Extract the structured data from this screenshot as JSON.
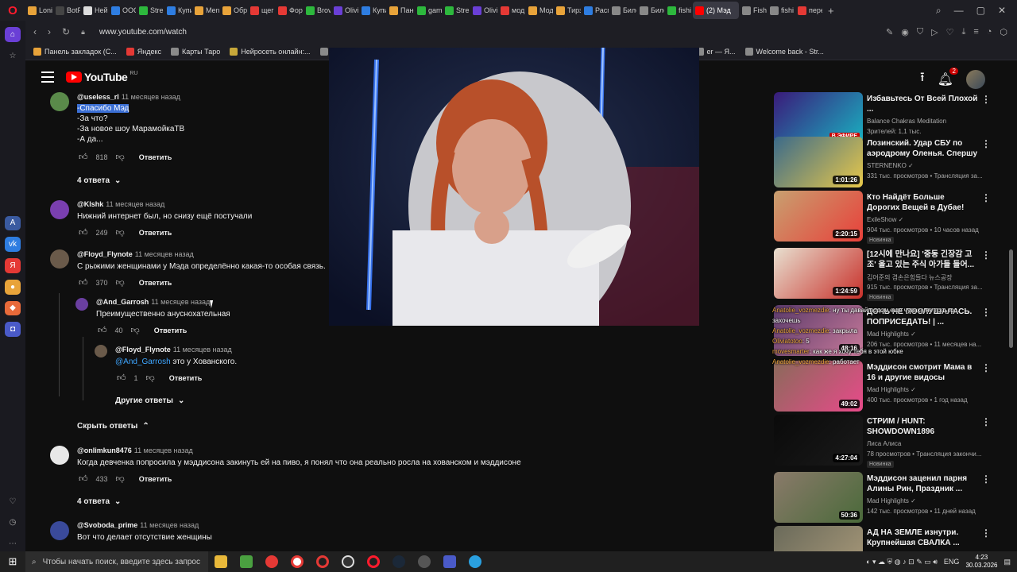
{
  "browser": {
    "tabs": [
      {
        "label": "Loni",
        "color": "#e8a33a"
      },
      {
        "label": "BotF",
        "color": "#444"
      },
      {
        "label": "Ней:",
        "color": "#ddd"
      },
      {
        "label": "OOC",
        "color": "#2e7de1"
      },
      {
        "label": "Stre",
        "color": "#2db83d"
      },
      {
        "label": "Купи",
        "color": "#2e7de1"
      },
      {
        "label": "Men",
        "color": "#e8a33a"
      },
      {
        "label": "Обр",
        "color": "#e8a33a"
      },
      {
        "label": "щег",
        "color": "#e53935"
      },
      {
        "label": "Фор",
        "color": "#e53935"
      },
      {
        "label": "Brov",
        "color": "#2db83d"
      },
      {
        "label": "Olivi",
        "color": "#6a3fd6"
      },
      {
        "label": "Купи",
        "color": "#2e7de1"
      },
      {
        "label": "Пане",
        "color": "#e8a33a"
      },
      {
        "label": "gam",
        "color": "#2db83d"
      },
      {
        "label": "Stre",
        "color": "#2db83d"
      },
      {
        "label": "Olivi",
        "color": "#6a3fd6"
      },
      {
        "label": "мод",
        "color": "#e53935"
      },
      {
        "label": "Мод",
        "color": "#e8a33a"
      },
      {
        "label": "Тирз",
        "color": "#e8a33a"
      },
      {
        "label": "Расп",
        "color": "#2e7de1"
      },
      {
        "label": "Биле",
        "color": "#888"
      },
      {
        "label": "Биле",
        "color": "#888"
      },
      {
        "label": "fishi",
        "color": "#2db83d"
      },
      {
        "label": "(2) Мэд",
        "color": "#ff0000",
        "active": true
      },
      {
        "label": "Fishi",
        "color": "#888"
      },
      {
        "label": "fishi",
        "color": "#888"
      },
      {
        "label": "пере",
        "color": "#e53935"
      }
    ],
    "url": "www.youtube.com/watch",
    "bookmarks": [
      {
        "label": "Панель закладок (С...",
        "color": "#e8a33a"
      },
      {
        "label": "Яндекс",
        "color": "#e53935"
      },
      {
        "label": "Карты Таро",
        "color": "#8a8a8a"
      },
      {
        "label": "Нейросеть онлайн:...",
        "color": "#c8a83a"
      },
      {
        "label": "Гадания он",
        "color": "#8a8a8a"
      },
      {
        "label": "er — Я...",
        "color": "#8a8a8a"
      },
      {
        "label": "Welcome back - Str...",
        "color": "#8a8a8a"
      }
    ]
  },
  "youtube": {
    "logo_text": "YouTube",
    "region": "RU",
    "notif_count": "2"
  },
  "comments": [
    {
      "author": "@useless_rl",
      "time": "11 месяцев назад",
      "highlight": "-Спасибо Мэд",
      "text": "-За что?\n-За новое шоу МарамойкаТВ\n-А да...",
      "likes": "818",
      "reply": "Ответить",
      "avatar": "#5a8a4a"
    },
    {
      "author": "@Klshk",
      "time": "11 месяцев назад",
      "text": "Нижний интернет был, но снизу ещё постучали",
      "likes": "249",
      "reply": "Ответить",
      "avatar": "#7a3fb0"
    },
    {
      "author": "@Floyd_Flynote",
      "time": "11 месяцев назад",
      "text": "С рыжими женщинами у Мэда определённо какая-то особая связь.",
      "likes": "370",
      "reply": "Ответить",
      "avatar": "#6a5a4a"
    },
    {
      "author": "@onlimkun8476",
      "time": "11 месяцев назад",
      "text": "Когда девченка попросила у мэддисона закинуть ей на пиво, я понял что она реально росла на хованском и мэддисоне",
      "likes": "433",
      "reply": "Ответить",
      "avatar": "#e8e8e8"
    },
    {
      "author": "@Svoboda_prime",
      "time": "11 месяцев назад",
      "text": "Вот что делает отсутствие женщины",
      "avatar": "#3a4a9a"
    }
  ],
  "replies": [
    {
      "author": "@And_Garrosh",
      "time": "11 месяцев назад",
      "text": "Преимущественно ануснохательная",
      "likes": "40",
      "reply": "Ответить",
      "avatar": "#6a3fa0"
    },
    {
      "author": "@Floyd_Flynote",
      "time": "11 месяцев назад",
      "mention": "@And_Garrosh",
      "text": "это у Хованского.",
      "likes": "1",
      "reply": "Ответить",
      "avatar": "#6a5a4a"
    }
  ],
  "reply_toggles": {
    "first": "4 ответа",
    "other": "Другие ответы",
    "hide": "Скрыть ответы",
    "second": "4 ответа"
  },
  "recommendations": [
    {
      "title": "Избавьтесь От Всей Плохой ...",
      "channel": "Balance Chakras Meditation",
      "meta": "Зрителей: 1,1 тыс.",
      "badge": "В ЭФИРЕ",
      "colors": [
        "#3a1a7a",
        "#1ab0c0"
      ]
    },
    {
      "title": "Лозинский. Удар СБУ по аэродрому Оленья. Спершу ...",
      "channel": "STERNENKO ✓",
      "meta": "331 тыс. просмотров • Трансляция за...",
      "duration": "1:01:26",
      "colors": [
        "#3a6a8a",
        "#e8c84a"
      ]
    },
    {
      "title": "Кто Найдёт Больше Дорогих Вещей в Дубае! (Бустер, ...",
      "channel": "ExileShow ✓",
      "meta": "904 тыс. просмотров • 10 часов назад",
      "duration": "2:20:15",
      "new": "Новинка",
      "colors": [
        "#c8a070",
        "#e8403a"
      ]
    },
    {
      "title": "[12시에 만나요] '중동 긴장감 고조' 올고 있는 주식 아가들 들어...",
      "channel": "김어준의 겸손은힘들다 뉴스공장",
      "meta": "915 тыс. просмотров • Трансляция за...",
      "duration": "1:24:59",
      "new": "Новинка",
      "colors": [
        "#e8e0d0",
        "#c8302a"
      ]
    },
    {
      "title": "ДОЧЬ НЕ ПОСЛУШАЛАСЬ. ПОПРИСЕДАТЬ! | ...",
      "channel": "Mad Highlights ✓",
      "meta": "206 тыс. просмотров • 11 месяцев на...",
      "duration": "48:16",
      "colors": [
        "#5a3a6a",
        "#c87a9a"
      ]
    },
    {
      "title": "Мэддисон смотрит Мама в 16 и другие видосы",
      "channel": "Mad Highlights ✓",
      "meta": "400 тыс. просмотров • 1 год назад",
      "duration": "49:02",
      "colors": [
        "#8a6a5a",
        "#e84a8a"
      ]
    },
    {
      "title": "СТРИМ / HUNT: SHOWDOWN1896",
      "channel": "Лиса Алиса",
      "meta": "78 просмотров • Трансляция закончи...",
      "duration": "4:27:04",
      "new": "Новинка",
      "colors": [
        "#0a0a0a",
        "#1a1a1a"
      ]
    },
    {
      "title": "Мэддисон заценил парня Алины Рин, Праздник ...",
      "channel": "Mad Highlights ✓",
      "meta": "142 тыс. просмотров • 11 дней назад",
      "duration": "50:36",
      "colors": [
        "#8a7a6a",
        "#4a6a3a"
      ]
    },
    {
      "title": "АД НА ЗЕМЛЕ изнутри. Крупнейшая СВАЛКА ...",
      "channel": "",
      "meta": "",
      "colors": [
        "#6a6a5a",
        "#aa9a7a"
      ]
    }
  ],
  "chat_overlay": [
    {
      "user": "Anatolie_vozmezdie",
      "text": ": ну ты давай подом еще чувака не только..."
    },
    {
      "user": "",
      "text": "захочешь"
    },
    {
      "user": "Anatolie_vozmezdie",
      "text": ": закрыла"
    },
    {
      "user": "Oliviatotoo",
      "text": ": 5"
    },
    {
      "user": "movesmarter",
      "text": ": как же я хочу тебя в этой юбке"
    },
    {
      "user": "Anatolie_vozmezdie",
      "text": ": работает"
    }
  ],
  "taskbar": {
    "search_placeholder": "Чтобы начать поиск, введите здесь запрос",
    "lang": "ENG",
    "time": "4:23",
    "date": "30.03.2026"
  }
}
